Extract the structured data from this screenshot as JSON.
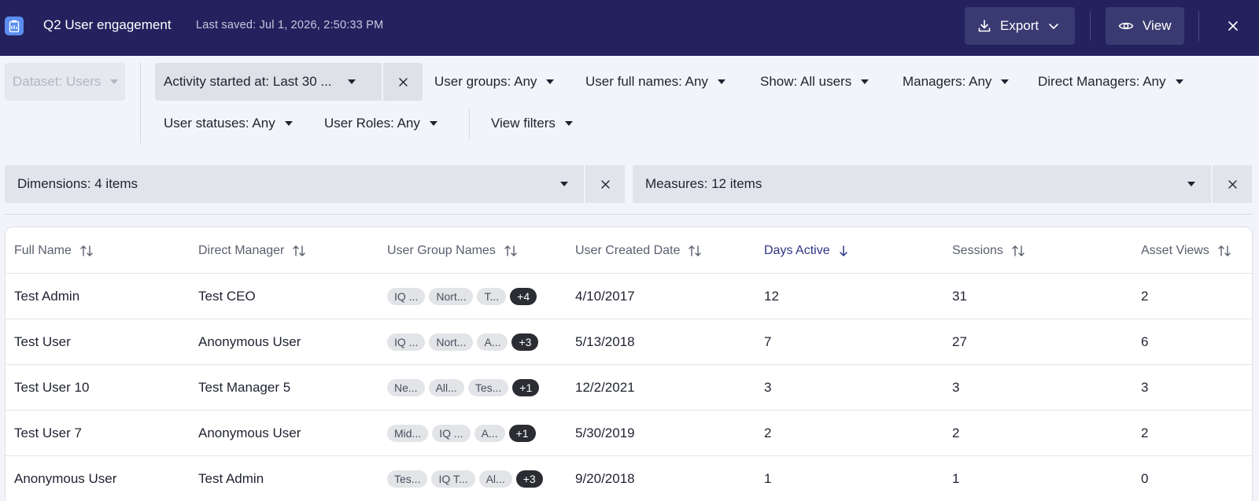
{
  "header": {
    "title": "Q2 User engagement",
    "last_saved": "Last saved: Jul 1, 2026, 2:50:33 PM",
    "export_label": "Export",
    "view_label": "View"
  },
  "filters": {
    "dataset": "Dataset: Users",
    "activity": "Activity started at: Last 30 ...",
    "user_groups": "User groups: Any",
    "user_full_names": "User full names: Any",
    "show": "Show: All users",
    "managers": "Managers: Any",
    "direct_managers": "Direct Managers: Any",
    "user_statuses": "User statuses: Any",
    "user_roles": "User Roles: Any",
    "view_filters": "View filters"
  },
  "dimensions_label": "Dimensions: 4 items",
  "measures_label": "Measures: 12 items",
  "table": {
    "columns": [
      "Full Name",
      "Direct Manager",
      "User Group Names",
      "User Created Date",
      "Days Active",
      "Sessions",
      "Asset Views"
    ],
    "sorted_column": "Days Active",
    "sort_direction": "descending",
    "rows": [
      {
        "full_name": "Test Admin",
        "direct_manager": "Test CEO",
        "groups": [
          "IQ ...",
          "Nort...",
          "T..."
        ],
        "more": "+4",
        "created": "4/10/2017",
        "days_active": "12",
        "sessions": "31",
        "asset_views": "2"
      },
      {
        "full_name": "Test User",
        "direct_manager": "Anonymous User",
        "groups": [
          "IQ ...",
          "Nort...",
          "A..."
        ],
        "more": "+3",
        "created": "5/13/2018",
        "days_active": "7",
        "sessions": "27",
        "asset_views": "6"
      },
      {
        "full_name": "Test User 10",
        "direct_manager": "Test Manager 5",
        "groups": [
          "Ne...",
          "All...",
          "Tes..."
        ],
        "more": "+1",
        "created": "12/2/2021",
        "days_active": "3",
        "sessions": "3",
        "asset_views": "3"
      },
      {
        "full_name": "Test User 7",
        "direct_manager": "Anonymous User",
        "groups": [
          "Mid...",
          "IQ ...",
          "A..."
        ],
        "more": "+1",
        "created": "5/30/2019",
        "days_active": "2",
        "sessions": "2",
        "asset_views": "2"
      },
      {
        "full_name": "Anonymous User",
        "direct_manager": "Test Admin",
        "groups": [
          "Tes...",
          "IQ T...",
          "Al..."
        ],
        "more": "+3",
        "created": "9/20/2018",
        "days_active": "1",
        "sessions": "1",
        "asset_views": "0"
      }
    ]
  },
  "icons": {
    "app": "clipboard-icon",
    "export": "download-icon",
    "view": "eye-icon",
    "close": "close-icon"
  },
  "colors": {
    "header_bg": "#23225e",
    "accent": "#2f3487",
    "chip_more_bg": "#2b2d33"
  }
}
